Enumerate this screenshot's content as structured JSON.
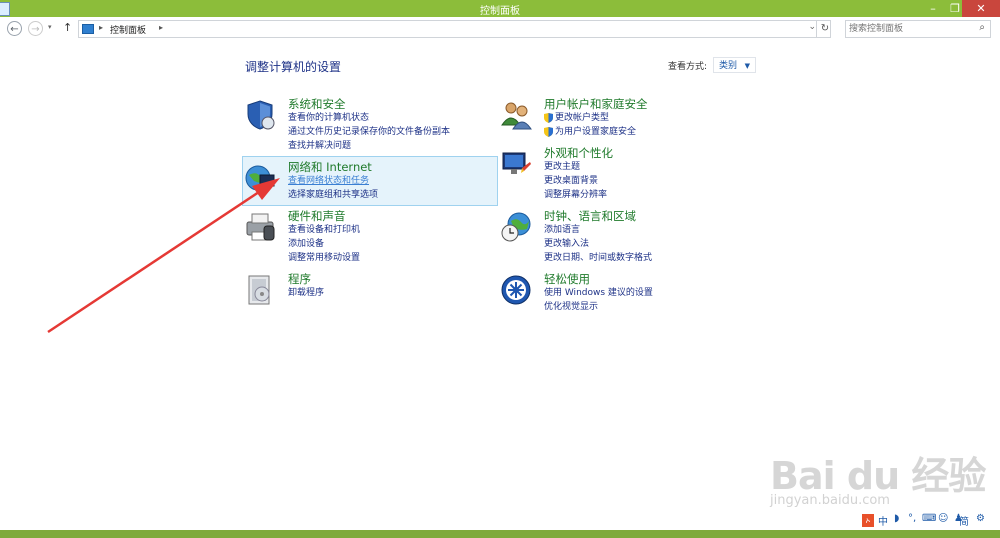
{
  "window": {
    "title": "控制面板",
    "minimize": "–",
    "restore": "❐",
    "close": "✕"
  },
  "address": {
    "back": "←",
    "forward": "→",
    "up": "↑",
    "crumb": "控制面板",
    "search_placeholder": "搜索控制面板",
    "refresh": "↻"
  },
  "main": {
    "heading": "调整计算机的设置",
    "view_by_label": "查看方式:",
    "view_by_value": "类别"
  },
  "categories": [
    {
      "title": "系统和安全",
      "icon": "shield-icon",
      "links": [
        "查看你的计算机状态",
        "通过文件历史记录保存你的文件备份副本",
        "查找并解决问题"
      ]
    },
    {
      "title": "网络和 Internet",
      "icon": "network-icon",
      "links": [
        "查看网络状态和任务",
        "选择家庭组和共享选项"
      ]
    },
    {
      "title": "硬件和声音",
      "icon": "printer-icon",
      "links": [
        "查看设备和打印机",
        "添加设备",
        "调整常用移动设置"
      ]
    },
    {
      "title": "程序",
      "icon": "programs-icon",
      "links": [
        "卸载程序"
      ]
    },
    {
      "title": "用户帐户和家庭安全",
      "icon": "users-icon",
      "links": [
        "更改帐户类型",
        "为用户设置家庭安全"
      ]
    },
    {
      "title": "外观和个性化",
      "icon": "display-icon",
      "links": [
        "更改主题",
        "更改桌面背景",
        "调整屏幕分辨率"
      ]
    },
    {
      "title": "时钟、语言和区域",
      "icon": "globe-clock-icon",
      "links": [
        "添加语言",
        "更改输入法",
        "更改日期、时间或数字格式"
      ]
    },
    {
      "title": "轻松使用",
      "icon": "ease-of-access-icon",
      "links": [
        "使用 Windows 建议的设置",
        "优化视觉显示"
      ]
    }
  ],
  "tray": {
    "ime": "中",
    "simplified": "简"
  },
  "watermark": {
    "brand": "Bai du 经验",
    "url": "jingyan.baidu.com"
  },
  "colors": {
    "titlebar": "#8cbd3a",
    "category_title": "#1f7a2b",
    "link": "#1e3287",
    "arrow": "#e53935"
  }
}
